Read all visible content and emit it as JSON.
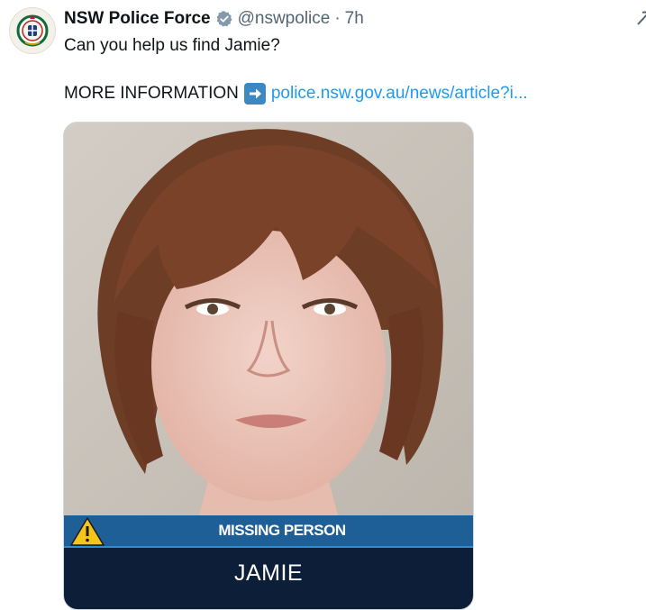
{
  "post": {
    "author_name": "NSW Police Force",
    "handle": "@nswpolice",
    "separator": "·",
    "time": "7h",
    "verified_icon": "verified-badge-icon",
    "avatar_icon": "nsw-police-crest-icon",
    "more_icon": "grok-icon",
    "text_line1": "Can you help us find Jamie?",
    "text_line2_prefix": "MORE INFORMATION",
    "arrow_emoji": "right-arrow-emoji-icon",
    "link_text": "police.nsw.gov.au/news/article?i..."
  },
  "media": {
    "banner_label": "MISSING PERSON",
    "warning_icon": "warning-triangle-icon",
    "person_name": "JAMIE",
    "colors": {
      "banner": "#1f5f98",
      "banner_stripe": "#2a8fd8",
      "name_box": "#0d1e38",
      "warning": "#f5c518",
      "link": "#1d9bf0",
      "verified": "#829aab"
    }
  }
}
